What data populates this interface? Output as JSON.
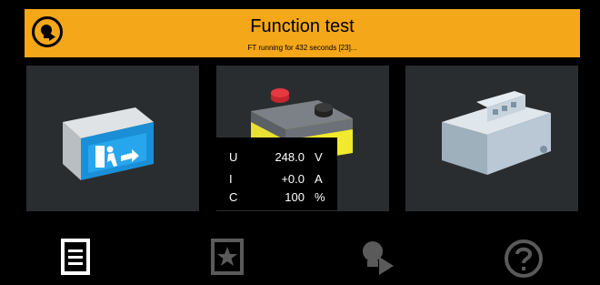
{
  "header": {
    "title": "Function test",
    "subtitle": "FT running for 432 seconds [23]...",
    "icon": "lamp-icon",
    "accent": "#f5a71a"
  },
  "tiles": [
    {
      "name": "emergency-exit-sign",
      "icon": "exit-sign-icon"
    },
    {
      "name": "battery",
      "icon": "battery-icon"
    },
    {
      "name": "din-rail-module",
      "icon": "din-module-icon"
    }
  ],
  "readings": [
    {
      "label": "U",
      "value": "248.0",
      "unit": "V"
    },
    {
      "label": "I",
      "value": "+0.0",
      "unit": "A"
    },
    {
      "label": "C",
      "value": "100",
      "unit": "%"
    }
  ],
  "nav": [
    {
      "name": "list-icon"
    },
    {
      "name": "star-icon"
    },
    {
      "name": "lamp-play-icon"
    },
    {
      "name": "help-icon"
    }
  ]
}
